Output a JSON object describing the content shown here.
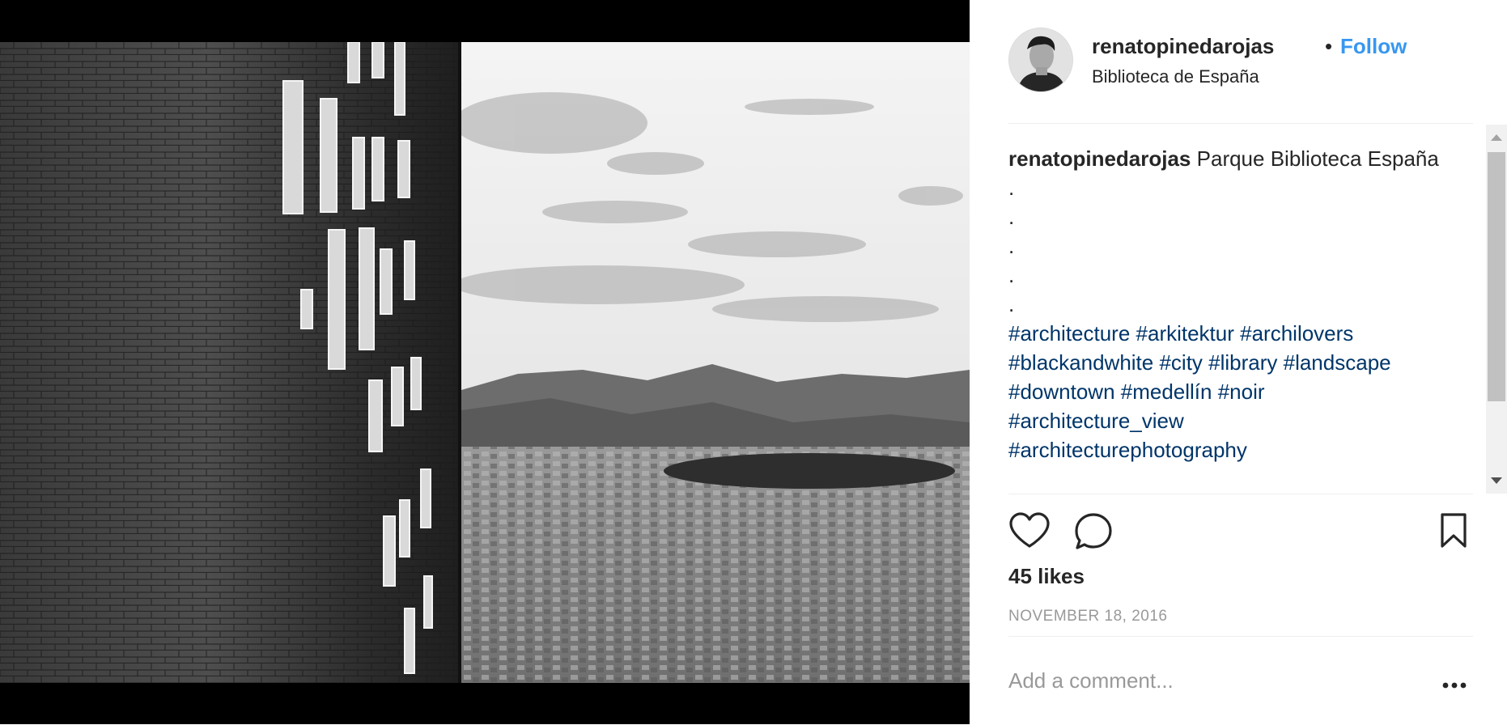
{
  "post": {
    "username": "renatopinedarojas",
    "separator": "•",
    "follow_label": "Follow",
    "location": "Biblioteca de España",
    "caption_text": "Parque Biblioteca España",
    "caption_dots": [
      ".",
      ".",
      ".",
      ".",
      "."
    ],
    "hashtags_lines": [
      "#architecture #arkitektur #archilovers",
      "#blackandwhite #city #library #landscape",
      "#downtown #medellín #noir",
      "#architecture_view",
      "#architecturephotography"
    ],
    "likes": "45 likes",
    "date": "NOVEMBER 18, 2016",
    "comment_placeholder": "Add a comment...",
    "more_label": "•••"
  },
  "icons": {
    "like": "heart-icon",
    "comment": "comment-bubble-icon",
    "save": "bookmark-icon",
    "more": "more-options-icon"
  },
  "colors": {
    "follow": "#3897f0",
    "hashtag": "#003569",
    "text": "#262626",
    "muted": "#999999"
  }
}
